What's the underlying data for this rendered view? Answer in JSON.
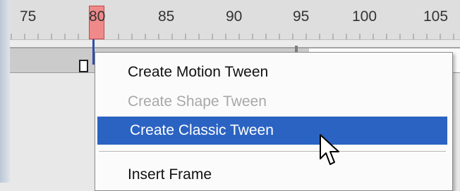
{
  "ruler": {
    "frames": [
      "75",
      "80",
      "85",
      "90",
      "95",
      "100",
      "105"
    ],
    "current_frame": "80"
  },
  "context_menu": {
    "items": [
      {
        "label": "Create Motion Tween",
        "enabled": true,
        "selected": false
      },
      {
        "label": "Create Shape Tween",
        "enabled": false,
        "selected": false
      },
      {
        "label": "Create Classic Tween",
        "enabled": true,
        "selected": true
      },
      {
        "label": "Insert Frame",
        "enabled": true,
        "selected": false
      }
    ]
  },
  "colors": {
    "highlight": "#2b63c2",
    "playhead": "#f08a8a",
    "disabled_text": "#a8a8a8"
  },
  "icons": {
    "cursor": "arrow-pointer-icon",
    "keyframe": "empty-keyframe-icon"
  }
}
